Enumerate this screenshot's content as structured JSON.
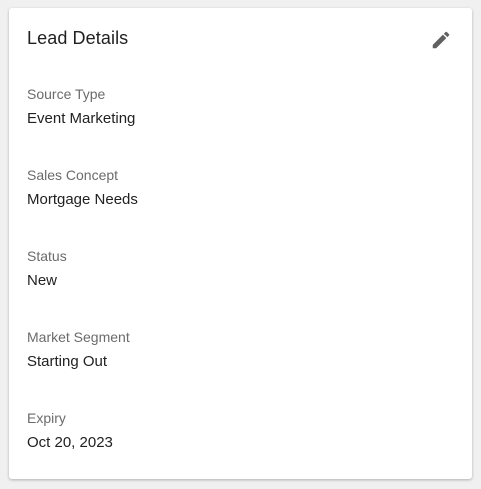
{
  "card": {
    "title": "Lead Details",
    "edit_icon": "pencil-icon",
    "fields": [
      {
        "label": "Source Type",
        "value": "Event Marketing"
      },
      {
        "label": "Sales Concept",
        "value": "Mortgage Needs"
      },
      {
        "label": "Status",
        "value": "New"
      },
      {
        "label": "Market Segment",
        "value": "Starting Out"
      },
      {
        "label": "Expiry",
        "value": "Oct 20, 2023"
      }
    ]
  },
  "colors": {
    "title": "#212121",
    "label": "#6b6b6b",
    "icon": "#616161"
  }
}
